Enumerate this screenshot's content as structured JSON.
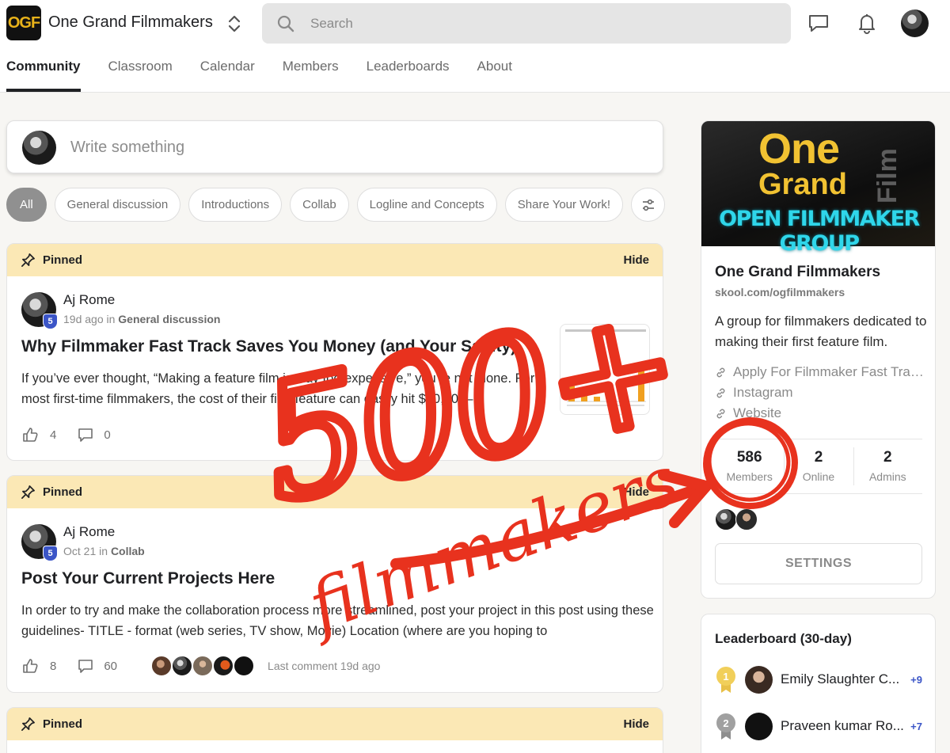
{
  "header": {
    "logo_text": "OGF",
    "group_name": "One Grand Filmmakers",
    "search_placeholder": "Search"
  },
  "tabs": [
    {
      "label": "Community",
      "active": true
    },
    {
      "label": "Classroom"
    },
    {
      "label": "Calendar"
    },
    {
      "label": "Members"
    },
    {
      "label": "Leaderboards"
    },
    {
      "label": "About"
    }
  ],
  "composer": {
    "placeholder": "Write something"
  },
  "filters": [
    "All",
    "General discussion",
    "Introductions",
    "Collab",
    "Logline and Concepts",
    "Share Your Work!"
  ],
  "posts": [
    {
      "pinned_label": "Pinned",
      "hide_label": "Hide",
      "author": "Aj Rome",
      "level": "5",
      "time": "19d ago",
      "in_word": "in",
      "category": "General discussion",
      "title": "Why Filmmaker Fast Track Saves You Money (and Your Sanity)",
      "body": "If you’ve ever thought, “Making a feature film is way too expensive,” you’re not alone. For most first-time filmmakers, the cost of their first feature can easily hit $30,000–",
      "likes": "4",
      "comments": "0"
    },
    {
      "pinned_label": "Pinned",
      "hide_label": "Hide",
      "author": "Aj Rome",
      "level": "5",
      "time": "Oct 21",
      "in_word": "in",
      "category": "Collab",
      "title": "Post Your Current Projects Here",
      "body": "In order to try and make the collaboration process more streamlined, post your project in this post using these guidelines- TITLE - format (web series, TV show, Movie) Location (where are you hoping to",
      "likes": "8",
      "comments": "60",
      "last_comment": "Last comment 19d ago"
    },
    {
      "pinned_label": "Pinned",
      "hide_label": "Hide"
    }
  ],
  "about": {
    "banner_line1": "One",
    "banner_line2": "Grand",
    "banner_vertical": "Film",
    "banner_tagline": "OPEN FILMMAKER GROUP",
    "name": "One Grand Filmmakers",
    "url": "skool.com/ogfilmmakers",
    "description": "A group for filmmakers dedicated to making their first feature film.",
    "links": [
      "Apply For Filmmaker Fast Tra…",
      "Instagram",
      "Website"
    ],
    "stats": [
      {
        "value": "586",
        "label": "Members"
      },
      {
        "value": "2",
        "label": "Online"
      },
      {
        "value": "2",
        "label": "Admins"
      }
    ],
    "settings_label": "SETTINGS"
  },
  "leaderboard": {
    "title": "Leaderboard (30-day)",
    "entries": [
      {
        "rank": "1",
        "name": "Emily Slaughter C...",
        "points": "+9"
      },
      {
        "rank": "2",
        "name": "Praveen kumar Ro...",
        "points": "+7"
      }
    ]
  },
  "annotation": {
    "big_text": "500+",
    "script_text": "filmmakers"
  },
  "colors": {
    "pinned_bg": "#fbe8b5",
    "level_badge": "#3b55c7",
    "annotation_red": "#e8321e",
    "logo_gold": "#e8b21a",
    "banner_cyan": "#2fd6ea"
  }
}
